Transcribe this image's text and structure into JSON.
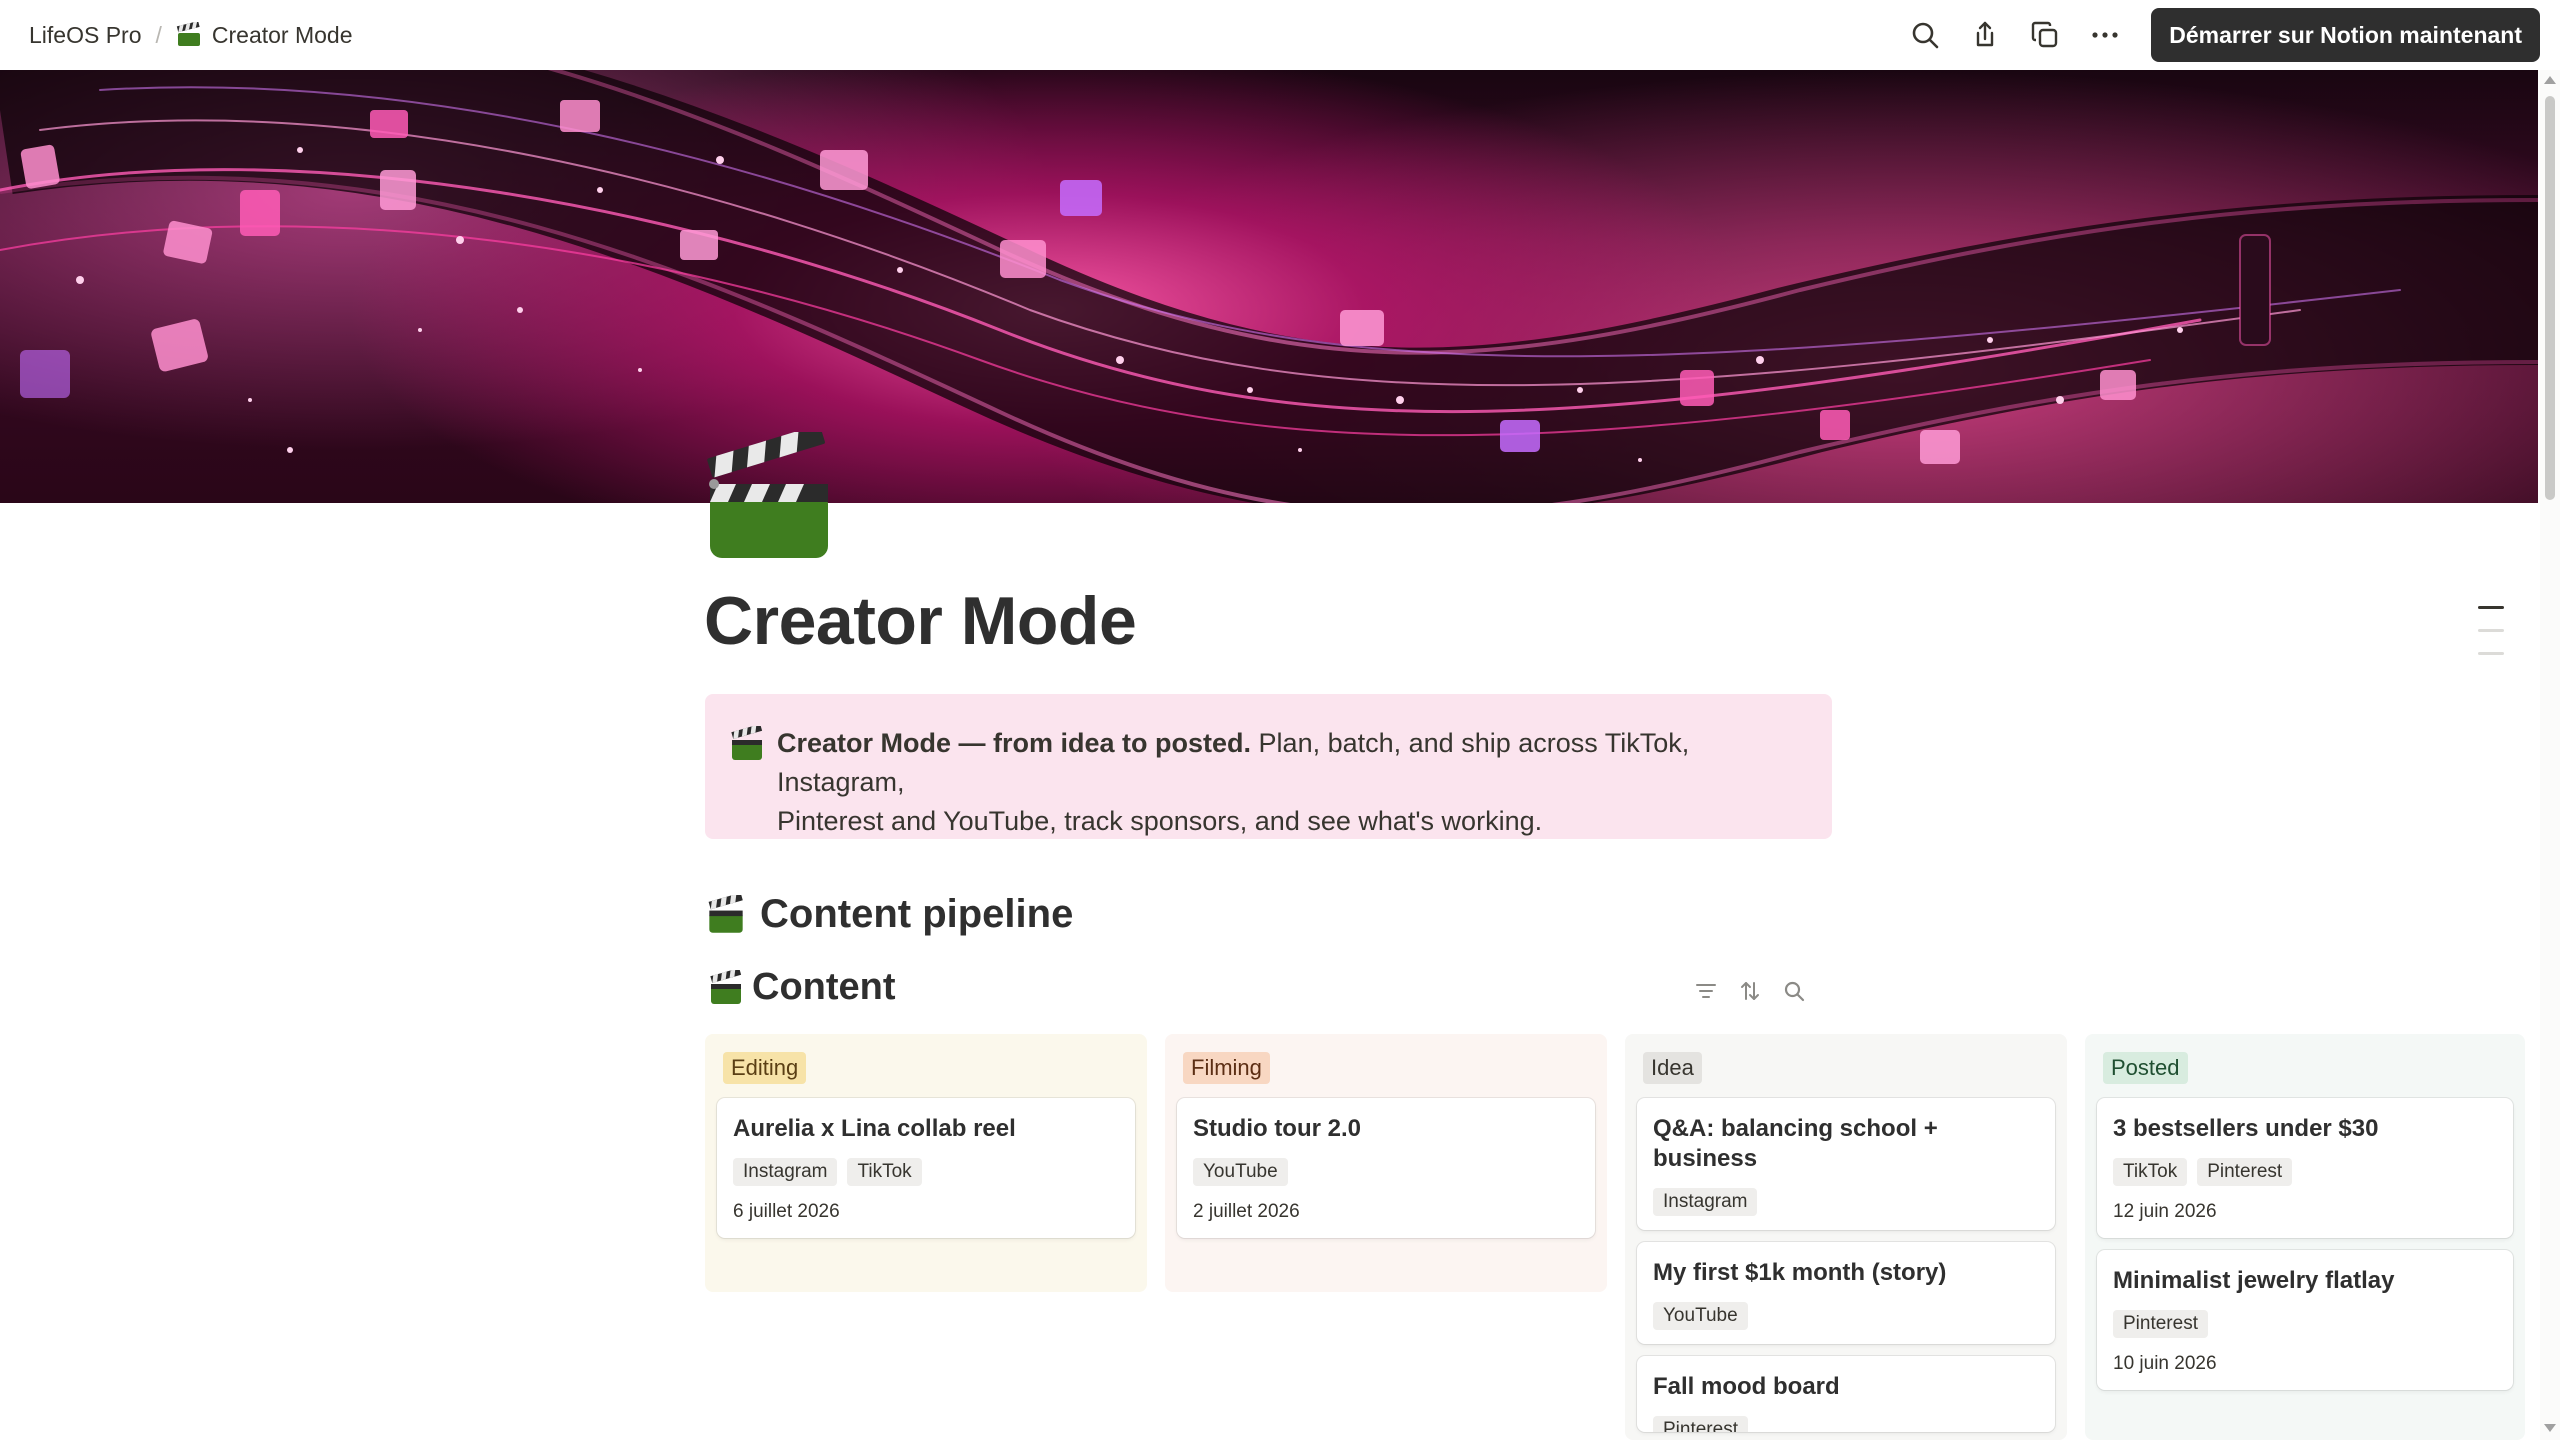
{
  "breadcrumb": {
    "workspace": "LifeOS Pro",
    "page": "Creator Mode"
  },
  "toolbar": {
    "cta_label": "Démarrer sur Notion maintenant"
  },
  "page": {
    "title": "Creator Mode"
  },
  "callout": {
    "bold": "Creator Mode — from idea to posted.",
    "text_line1": " Plan, batch, and ship across TikTok, Instagram,",
    "text_line2": "Pinterest and YouTube, track sponsors, and see what's working."
  },
  "section": {
    "heading": "Content pipeline"
  },
  "database": {
    "title": "Content"
  },
  "board": {
    "columns": [
      {
        "status": "Editing",
        "cards": [
          {
            "title": "Aurelia x Lina collab reel",
            "tags": [
              "Instagram",
              "TikTok"
            ],
            "date": "6 juillet 2026"
          }
        ]
      },
      {
        "status": "Filming",
        "cards": [
          {
            "title": "Studio tour 2.0",
            "tags": [
              "YouTube"
            ],
            "date": "2 juillet 2026"
          }
        ]
      },
      {
        "status": "Idea",
        "cards": [
          {
            "title": "Q&A: balancing school + business",
            "tags": [
              "Instagram"
            ]
          },
          {
            "title": "My first $1k month (story)",
            "tags": [
              "YouTube"
            ]
          },
          {
            "title": "Fall mood board",
            "tags": [
              "Pinterest"
            ]
          }
        ]
      },
      {
        "status": "Posted",
        "cards": [
          {
            "title": "3 bestsellers under $30",
            "tags": [
              "TikTok",
              "Pinterest"
            ],
            "date": "12 juin 2026"
          },
          {
            "title": "Minimalist jewelry flatlay",
            "tags": [
              "Pinterest"
            ],
            "date": "10 juin 2026"
          }
        ]
      }
    ]
  },
  "colors": {
    "callout_bg": "#fbe4ee",
    "cta_bg": "#2f2f2f",
    "cover_accent": "#ff3fa4"
  },
  "icons": [
    "search-icon",
    "share-icon",
    "duplicate-icon",
    "more-icon",
    "clapper-board-icon",
    "filter-icon",
    "sort-icon"
  ]
}
